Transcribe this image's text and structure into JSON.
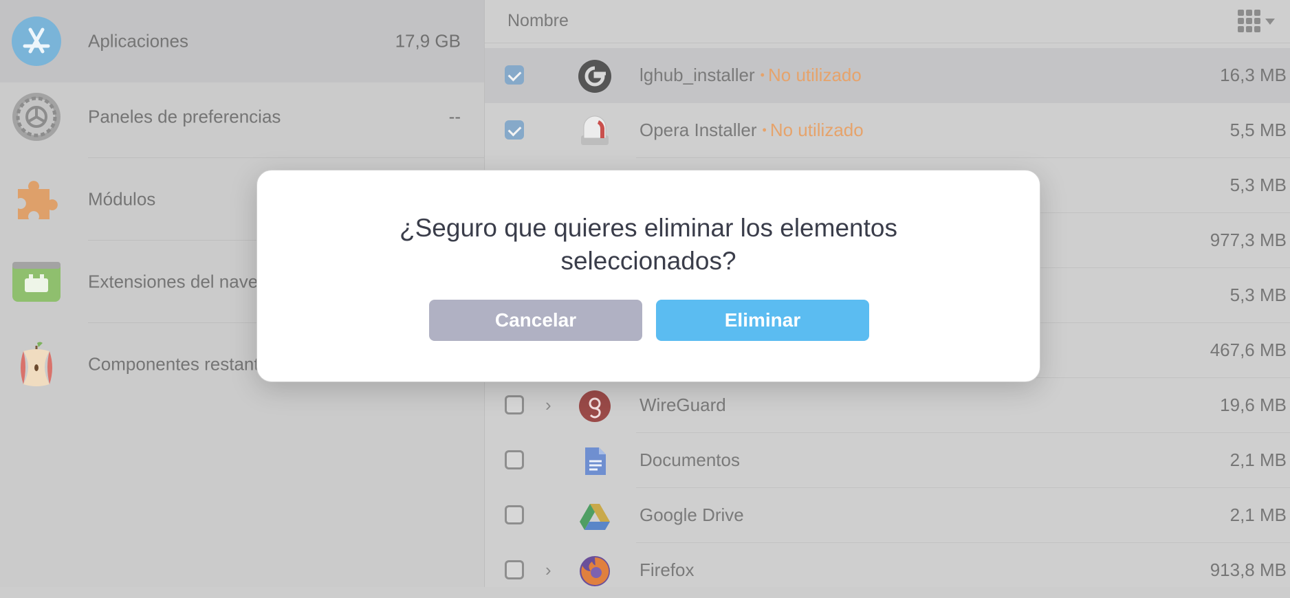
{
  "sidebar": {
    "categories": [
      {
        "label": "Aplicaciones",
        "size": "17,9 GB",
        "icon": "app-store-icon"
      },
      {
        "label": "Paneles de preferencias",
        "size": "--",
        "icon": "gear-icon"
      },
      {
        "label": "Módulos",
        "size": "",
        "icon": "puzzle-icon"
      },
      {
        "label": "Extensiones del navegador",
        "size": "",
        "icon": "browser-extension-icon"
      },
      {
        "label": "Componentes restantes",
        "size": "",
        "icon": "apple-core-icon"
      }
    ]
  },
  "list": {
    "column_name": "Nombre",
    "rows": [
      {
        "name": "lghub_installer",
        "status": "No utilizado",
        "size": "16,3 MB",
        "checked": true,
        "icon": "logitech-g-icon"
      },
      {
        "name": "Opera Installer",
        "status": "No utilizado",
        "size": "5,5 MB",
        "checked": true,
        "icon": "opera-installer-icon"
      },
      {
        "name": "",
        "size": "5,3 MB"
      },
      {
        "name": "",
        "size": "977,3 MB"
      },
      {
        "name": "",
        "size": "5,3 MB"
      },
      {
        "name": "",
        "size": "467,6 MB"
      },
      {
        "name": "WireGuard",
        "size": "19,6 MB",
        "checked": false,
        "expandable": true,
        "icon": "wireguard-icon"
      },
      {
        "name": "Documentos",
        "size": "2,1 MB",
        "checked": false,
        "icon": "google-docs-icon"
      },
      {
        "name": "Google Drive",
        "size": "2,1 MB",
        "checked": false,
        "icon": "google-drive-icon"
      },
      {
        "name": "Firefox",
        "size": "913,8 MB",
        "checked": false,
        "expandable": true,
        "icon": "firefox-icon"
      }
    ]
  },
  "dialog": {
    "message": "¿Seguro que quieres eliminar los elementos seleccionados?",
    "cancel_label": "Cancelar",
    "confirm_label": "Eliminar"
  },
  "colors": {
    "accent": "#5bbcf1",
    "cancel": "#b0b1c3",
    "unused": "#e6a36b"
  }
}
